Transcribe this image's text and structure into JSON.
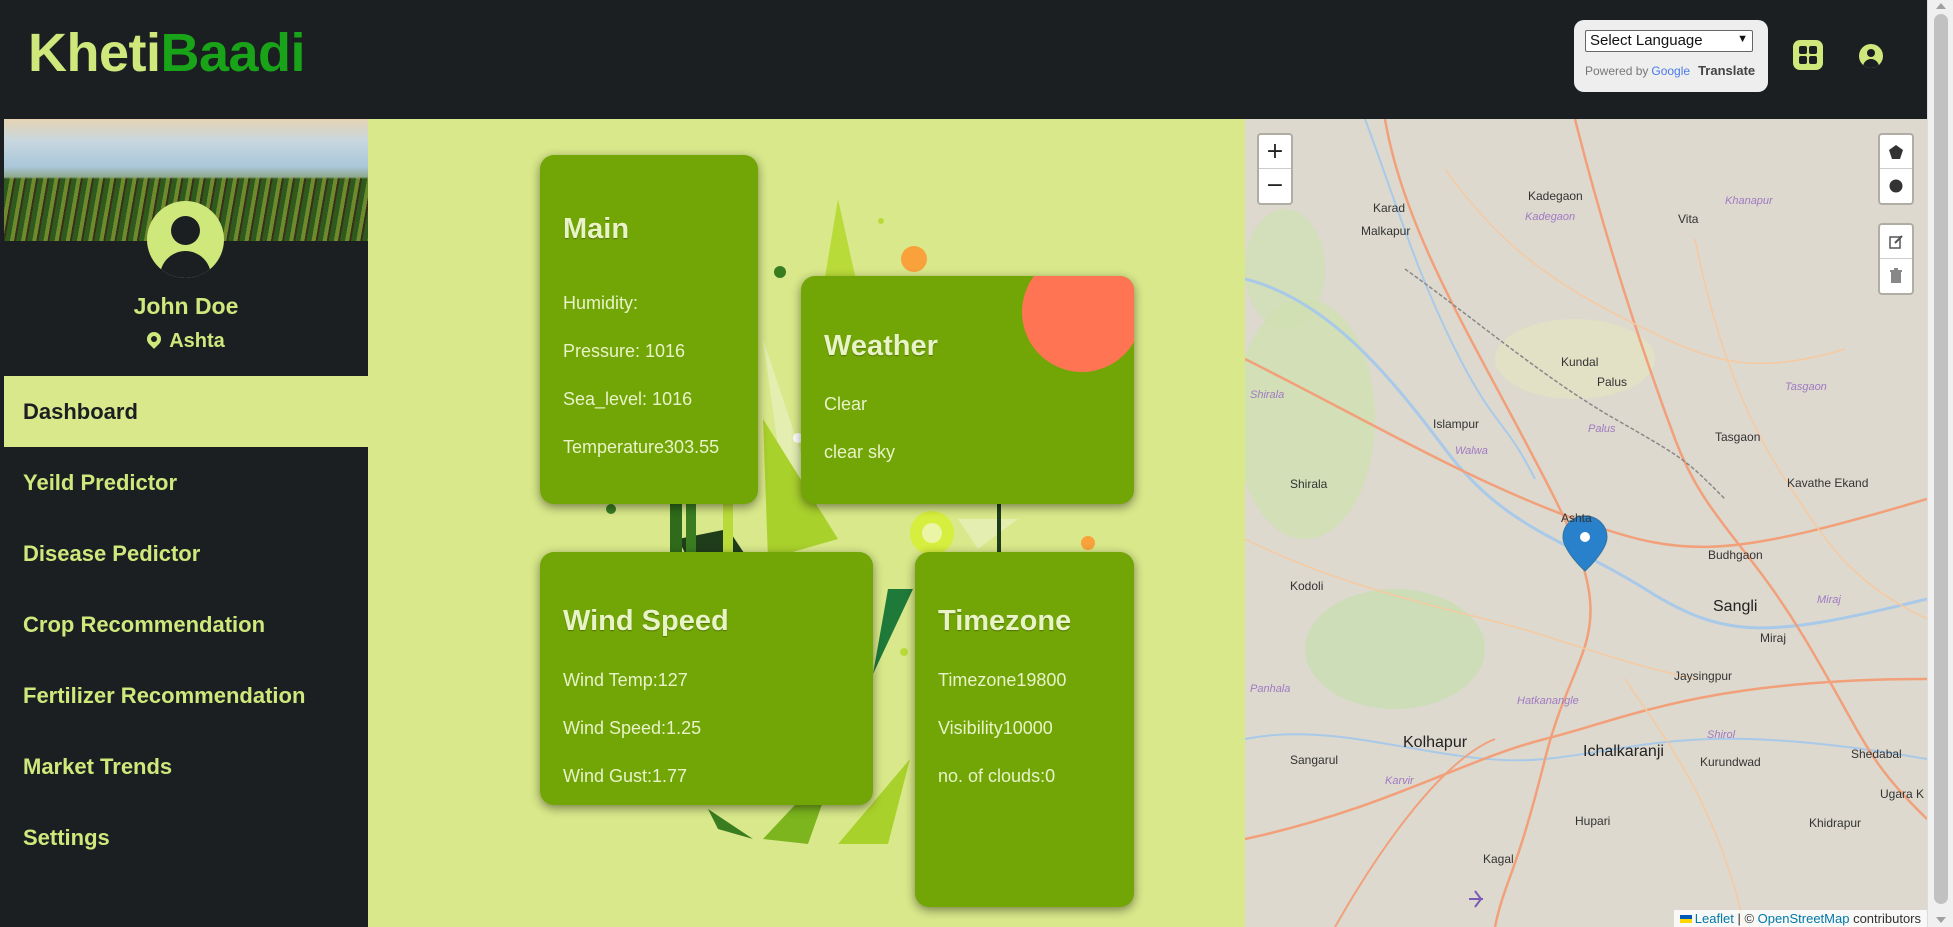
{
  "header": {
    "logo_part1": "Kheti",
    "logo_part2": "Baadi",
    "language_select": "Select Language",
    "powered_by": "Powered by",
    "google": "Google",
    "translate": "Translate"
  },
  "sidebar": {
    "user_name": "John Doe",
    "location": "Ashta",
    "items": [
      {
        "label": "Dashboard",
        "active": true
      },
      {
        "label": "Yeild Predictor"
      },
      {
        "label": "Disease Pedictor"
      },
      {
        "label": "Crop Recommendation"
      },
      {
        "label": "Fertilizer Recommendation"
      },
      {
        "label": "Market Trends"
      },
      {
        "label": "Settings"
      }
    ]
  },
  "cards": {
    "main": {
      "title": "Main",
      "humidity": "Humidity:",
      "pressure": "Pressure: 1016",
      "sea_level": "Sea_level: 1016",
      "temperature": "Temperature303.55"
    },
    "weather": {
      "title": "Weather",
      "main": "Clear",
      "description": "clear sky"
    },
    "wind": {
      "title": "Wind Speed",
      "temp": "Wind Temp:127",
      "speed": "Wind Speed:1.25",
      "gust": "Wind Gust:1.77"
    },
    "timezone": {
      "title": "Timezone",
      "timezone": "Timezone19800",
      "visibility": "Visibility10000",
      "clouds": "no. of clouds:0"
    }
  },
  "map": {
    "zoom_in": "+",
    "zoom_out": "−",
    "attribution_leaflet": "Leaflet",
    "attribution_sep": "| ©",
    "attribution_osm": "OpenStreetMap",
    "attribution_contrib": "contributors",
    "places": [
      "Karad",
      "Kadegaon",
      "Vita",
      "Malkapur",
      "Kadegaon",
      "Khanapur",
      "Kundal",
      "Palus",
      "Islampur",
      "Walwa",
      "Palus",
      "Tasgaon",
      "Tasgaon",
      "Shirala",
      "Kavathe Ekand",
      "Ashta",
      "Budhgaon",
      "Kodoli",
      "Sangli",
      "Miraj",
      "Miraj",
      "Jaysingpur",
      "Hatkanangle",
      "Kolhapur",
      "Ichalkaranji",
      "Sangarul",
      "Karvir",
      "Kurundwad",
      "Shirol",
      "Shedabal",
      "Ugara K",
      "Hupari",
      "Khidrapur",
      "Kagal",
      "Panhala",
      "Shirala"
    ]
  },
  "colors": {
    "dark": "#1b1f22",
    "lime": "#cfe87c",
    "panel_bg": "#d8e88a",
    "card": "#72a506",
    "accent_orange": "#ff7553",
    "logo_green": "#18a318"
  }
}
